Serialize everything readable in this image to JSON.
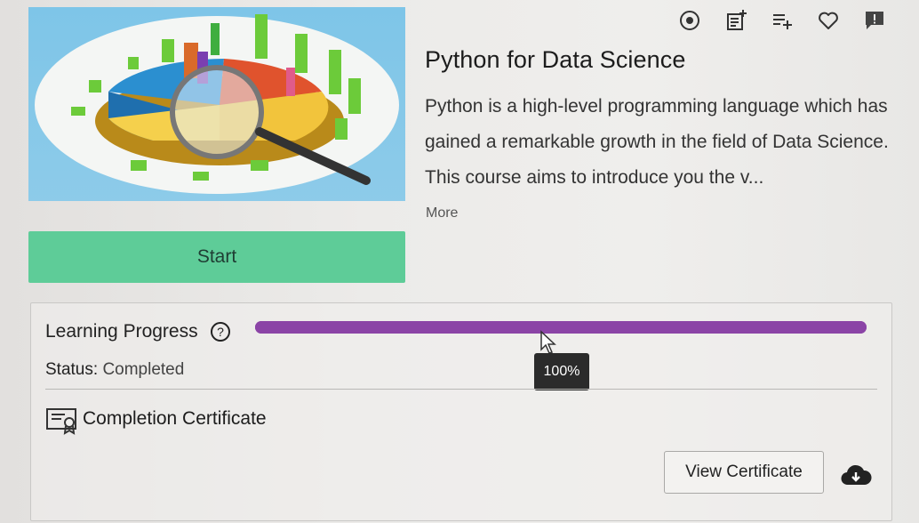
{
  "course": {
    "title": "Python for Data Science",
    "description": "Python is a high-level programming language which has gained a remarkable growth in the field of Data Science. This course aims to introduce you the v...",
    "more_label": "More",
    "start_label": "Start"
  },
  "top_icons": [
    "target-icon",
    "add-note-icon",
    "add-to-playlist-icon",
    "heart-icon",
    "report-icon"
  ],
  "progress": {
    "label": "Learning Progress",
    "percent": 100,
    "percent_text": "100%",
    "status_label": "Status:",
    "status_value": "Completed"
  },
  "certificate": {
    "label": "Completion Certificate",
    "view_label": "View Certificate"
  },
  "colors": {
    "start_button": "#5ecc98",
    "progress_bar": "#8b44a6",
    "tooltip": "#2b2b2b"
  }
}
